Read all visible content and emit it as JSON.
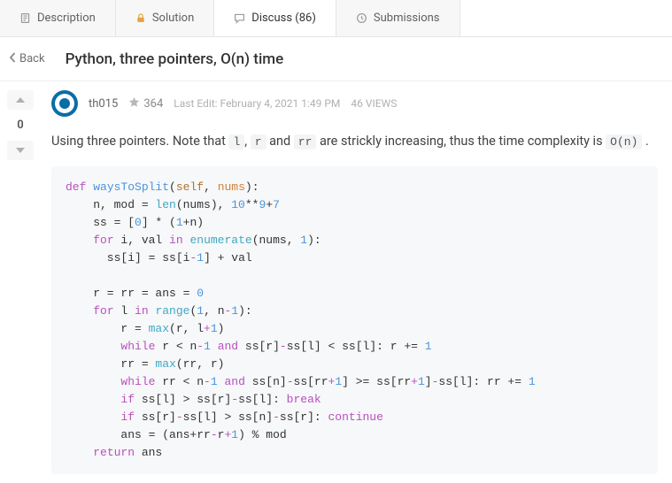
{
  "tabs": {
    "description": "Description",
    "solution": "Solution",
    "discuss": "Discuss (86)",
    "submissions": "Submissions"
  },
  "back": "Back",
  "title": "Python, three pointers, O(n) time",
  "vote_count": "0",
  "author": {
    "name": "th015",
    "rep": "364"
  },
  "last_edit": "Last Edit: February 4, 2021 1:49 PM",
  "views": "46 VIEWS",
  "body": {
    "pre1": "Using three pointers. Note that ",
    "c1": "l",
    "sep1": ", ",
    "c2": "r",
    "sep2": " and ",
    "c3": "rr",
    "post1": " are strickly increasing, thus the time complexity is ",
    "c4": "O(n)",
    "end": " ."
  },
  "code": {
    "l1_def": "def",
    "l1_fn": "waysToSplit",
    "l1_self": "self",
    "l1_nums": "nums",
    "l2_len": "len",
    "l2_ten": "10",
    "l2_nine": "9",
    "l2_seven": "7",
    "l3_zero": "0",
    "l3_one": "1",
    "l4_for": "for",
    "l4_in": "in",
    "l4_enum": "enumerate",
    "l4_one": "1",
    "l5_one": "1",
    "l6_zero": "0",
    "l7_for": "for",
    "l7_in": "in",
    "l7_range": "range",
    "l7_one": "1",
    "l7_one2": "1",
    "l8_max": "max",
    "l8_one": "1",
    "l9_while": "while",
    "l9_one": "1",
    "l9_and": "and",
    "l9_one2": "1",
    "l10_max": "max",
    "l11_while": "while",
    "l11_one": "1",
    "l11_and": "and",
    "l11_one2": "1",
    "l11_one3": "1",
    "l11_one4": "1",
    "l12_if": "if",
    "l12_break": "break",
    "l13_if": "if",
    "l13_continue": "continue",
    "l14_one": "1",
    "l15_return": "return"
  }
}
